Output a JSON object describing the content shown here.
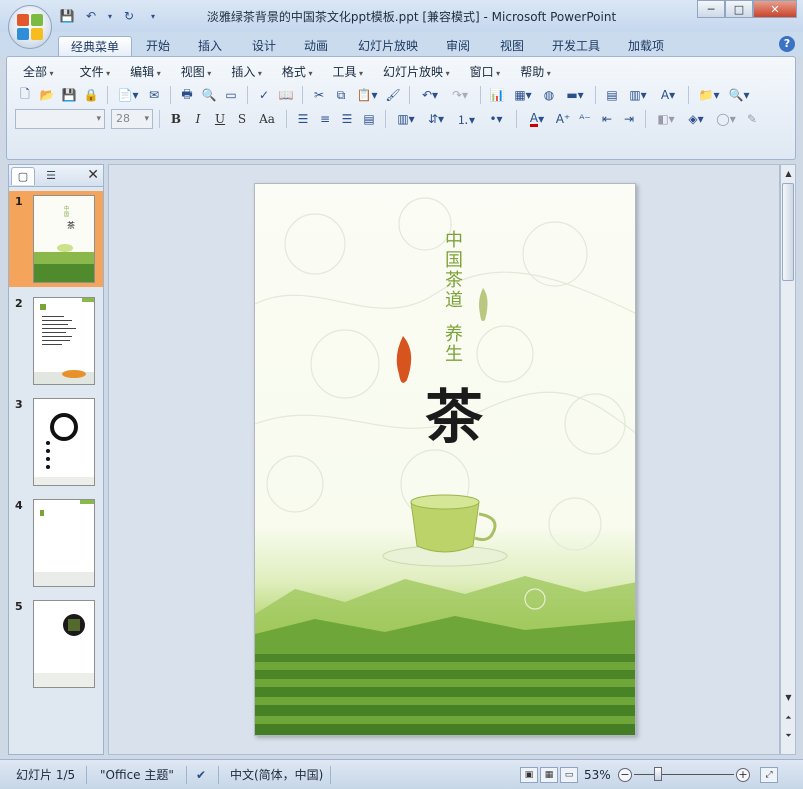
{
  "window": {
    "title": "淡雅绿茶背景的中国茶文化ppt模板.ppt [兼容模式] - Microsoft PowerPoint"
  },
  "ribbon_tabs": [
    "经典菜单",
    "开始",
    "插入",
    "设计",
    "动画",
    "幻灯片放映",
    "审阅",
    "视图",
    "开发工具",
    "加载项"
  ],
  "classic_menu": [
    "全部",
    "文件",
    "编辑",
    "视图",
    "插入",
    "格式",
    "工具",
    "幻灯片放映",
    "窗口",
    "帮助"
  ],
  "format_bar": {
    "font_name": "",
    "font_size": "28",
    "bold": "B",
    "italic": "I",
    "underline": "U",
    "shadow": "S",
    "change_case": "Aa"
  },
  "slides_pane": {
    "numbers": [
      "1",
      "2",
      "3",
      "4",
      "5"
    ],
    "selected": 1
  },
  "slide": {
    "text_vertical_1": "中国茶道",
    "text_vertical_2": "养生",
    "big_char": "茶"
  },
  "status": {
    "slide_info": "幻灯片 1/5",
    "theme": "\"Office 主题\"",
    "language": "中文(简体，中国)",
    "zoom": "53%"
  },
  "colors": {
    "accent_green": "#7ea23a",
    "selection_orange": "#f5a45b"
  }
}
